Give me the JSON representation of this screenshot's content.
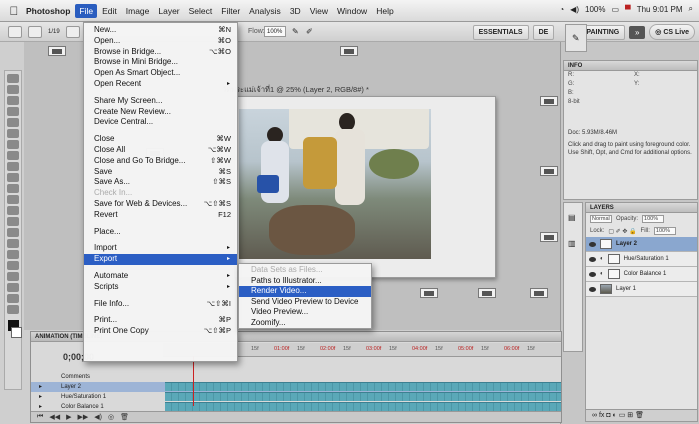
{
  "menubar": {
    "apple": "",
    "app": "Photoshop",
    "items": [
      "File",
      "Edit",
      "Image",
      "Layer",
      "Select",
      "Filter",
      "Analysis",
      "3D",
      "View",
      "Window",
      "Help"
    ],
    "battery": "100%",
    "clock": "Thu 9:01 PM"
  },
  "options": {
    "brush_size": "1/19",
    "flow_label": "Flow:",
    "flow_value": "100%"
  },
  "workspace": {
    "essentials": "ESSENTIALS",
    "design_partial": "DE",
    "painting": "PAINTING",
    "more": "»",
    "cs_live": "CS Live"
  },
  "document": {
    "tab": "วัดพระแม่เจ้าที่1 @ 25% (Layer 2, RGB/8#) *"
  },
  "file_menu": {
    "items": [
      {
        "label": "New...",
        "shortcut": "⌘N"
      },
      {
        "label": "Open...",
        "shortcut": "⌘O"
      },
      {
        "label": "Browse in Bridge...",
        "shortcut": "⌥⌘O"
      },
      {
        "label": "Browse in Mini Bridge...",
        "shortcut": ""
      },
      {
        "label": "Open As Smart Object...",
        "shortcut": ""
      },
      {
        "label": "Open Recent",
        "shortcut": "▸"
      },
      {
        "sep": true
      },
      {
        "label": "Share My Screen...",
        "shortcut": ""
      },
      {
        "label": "Create New Review...",
        "shortcut": ""
      },
      {
        "label": "Device Central...",
        "shortcut": ""
      },
      {
        "sep": true
      },
      {
        "label": "Close",
        "shortcut": "⌘W"
      },
      {
        "label": "Close All",
        "shortcut": "⌥⌘W"
      },
      {
        "label": "Close and Go To Bridge...",
        "shortcut": "⇧⌘W"
      },
      {
        "label": "Save",
        "shortcut": "⌘S"
      },
      {
        "label": "Save As...",
        "shortcut": "⇧⌘S"
      },
      {
        "label": "Check In...",
        "shortcut": "",
        "disabled": true
      },
      {
        "label": "Save for Web & Devices...",
        "shortcut": "⌥⇧⌘S"
      },
      {
        "label": "Revert",
        "shortcut": "F12"
      },
      {
        "sep": true
      },
      {
        "label": "Place...",
        "shortcut": ""
      },
      {
        "sep": true
      },
      {
        "label": "Import",
        "shortcut": "▸"
      },
      {
        "label": "Export",
        "shortcut": "▸",
        "highlighted": true
      },
      {
        "sep": true
      },
      {
        "label": "Automate",
        "shortcut": "▸"
      },
      {
        "label": "Scripts",
        "shortcut": "▸"
      },
      {
        "sep": true
      },
      {
        "label": "File Info...",
        "shortcut": "⌥⇧⌘I"
      },
      {
        "sep": true
      },
      {
        "label": "Print...",
        "shortcut": "⌘P"
      },
      {
        "label": "Print One Copy",
        "shortcut": "⌥⇧⌘P"
      }
    ]
  },
  "export_submenu": {
    "items": [
      {
        "label": "Data Sets as Files...",
        "disabled": true
      },
      {
        "label": "Paths to Illustrator..."
      },
      {
        "label": "Render Video...",
        "highlighted": true
      },
      {
        "label": "Send Video Preview to Device"
      },
      {
        "label": "Video Preview..."
      },
      {
        "label": "Zoomify..."
      }
    ]
  },
  "info_panel": {
    "tab": "INFO",
    "rows": [
      "R:",
      "G:",
      "B:",
      "8-bit",
      "X:",
      "Y:"
    ],
    "doc": "Doc: 5.93M/8.46M",
    "help": "Click and drag to paint using foreground color. Use Shift, Opt, and Cmd for additional options."
  },
  "layers_panel": {
    "tab": "LAYERS",
    "blend_mode": "Normal",
    "opacity_label": "Opacity:",
    "opacity": "100%",
    "lock_label": "Lock:",
    "fill_label": "Fill:",
    "fill": "100%",
    "layers": [
      {
        "name": "Layer 2",
        "selected": true
      },
      {
        "name": "Hue/Saturation 1"
      },
      {
        "name": "Color Balance 1"
      },
      {
        "name": "Layer 1"
      }
    ]
  },
  "timeline": {
    "tab": "ANIMATION (TIMELINE)",
    "time": "0;00;00",
    "ticks": [
      "15f",
      "01:00f",
      "15f",
      "02:00f",
      "15f",
      "03:00f",
      "15f",
      "04:00f",
      "15f",
      "05:00f",
      "15f",
      "06:00f",
      "15f"
    ],
    "rows": [
      "Comments",
      "Layer 2",
      "Hue/Saturation 1",
      "Color Balance 1"
    ]
  },
  "colors": {
    "highlight": "#2b5ec4",
    "timeline_bar": "#5aa8b8",
    "playhead": "#cc2222"
  }
}
